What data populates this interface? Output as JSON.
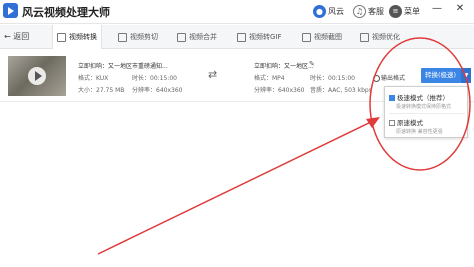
{
  "app": {
    "title": "风云视频处理大师"
  },
  "titlebar": {
    "fengyun_label": "风云",
    "service_label": "客服",
    "menu_label": "菜单",
    "minimize": "—",
    "close": "✕"
  },
  "nav": {
    "back_label": "返回",
    "tabs": [
      {
        "label": "视频转换"
      },
      {
        "label": "视频剪切"
      },
      {
        "label": "视频合并"
      },
      {
        "label": "视频转GIF"
      },
      {
        "label": "视频截图"
      },
      {
        "label": "视频优化"
      }
    ]
  },
  "file": {
    "source": {
      "title": "立即扣响：又一地区市重磅通知...",
      "format": "格式：KUX",
      "duration": "时长：00:15:00",
      "size": "大小：27.75 MB",
      "resolution": "分辨率：640x360"
    },
    "target": {
      "title": "立即扣响：又一地区...",
      "format": "格式：MP4",
      "duration": "时长：00:15:00",
      "resolution": "分辨率：640x360",
      "audio": "音质：AAC, 503 kbps"
    }
  },
  "controls": {
    "output_label": "输出格式",
    "convert_label": "转换(极速)",
    "arrow": "▼"
  },
  "dropdown": {
    "options": [
      {
        "label": "极速模式（推荐）",
        "desc": "极速转换模式保持原格式",
        "checked": true
      },
      {
        "label": "原速模式",
        "desc": "原速转换 兼容性更强",
        "checked": false
      }
    ]
  }
}
